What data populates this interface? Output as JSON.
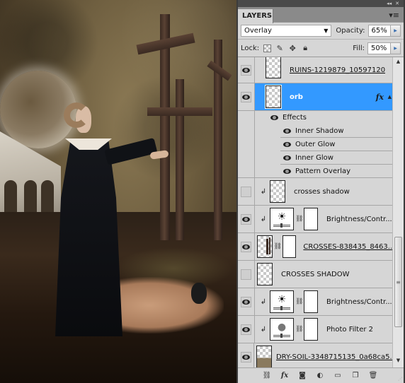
{
  "canvas": {
    "description": "Composite artwork: horned woman in black coat pointing, three wooden crosses, orb, aqueduct ruins, kneeling figure with gas mask on dry soil"
  },
  "panel": {
    "window_controls": {
      "collapse": "◂◂",
      "close": "✕"
    },
    "tab_label": "LAYERS",
    "menu_icon": "▾≡",
    "blend_mode": "Overlay",
    "opacity_label": "Opacity:",
    "opacity_value": "65%",
    "lock_label": "Lock:",
    "fill_label": "Fill:",
    "fill_value": "50%",
    "layers": [
      {
        "name": "RUINS-1219879_10597120",
        "visible": true,
        "linked": true,
        "type": "pixel"
      },
      {
        "name": "orb",
        "visible": true,
        "selected": true,
        "type": "pixel",
        "fx": "fx",
        "effects_label": "Effects",
        "effects": [
          "Inner Shadow",
          "Outer Glow",
          "Inner Glow",
          "Pattern Overlay"
        ]
      },
      {
        "name": "crosses shadow",
        "visible": false,
        "clipped": true,
        "type": "pixel"
      },
      {
        "name": "Brightness/Contr...",
        "visible": true,
        "clipped": true,
        "type": "adjustment-brightness"
      },
      {
        "name": "CROSSES-838435_8463...",
        "visible": true,
        "linked": true,
        "type": "pixel-with-mask"
      },
      {
        "name": "CROSSES SHADOW",
        "visible": false,
        "type": "pixel"
      },
      {
        "name": "Brightness/Contr...",
        "visible": true,
        "clipped": true,
        "type": "adjustment-brightness"
      },
      {
        "name": "Photo Filter 2",
        "visible": true,
        "clipped": true,
        "type": "adjustment-photo-filter"
      },
      {
        "name": "DRY-SOIL-3348715135_0a68ca5...",
        "visible": true,
        "linked": true,
        "type": "pixel"
      }
    ],
    "bottom_icons": [
      "link-layers-icon",
      "fx-icon",
      "add-mask-icon",
      "adjustment-layer-icon",
      "new-group-icon",
      "new-layer-icon",
      "delete-layer-icon"
    ],
    "selected_color": "#3399ff"
  }
}
